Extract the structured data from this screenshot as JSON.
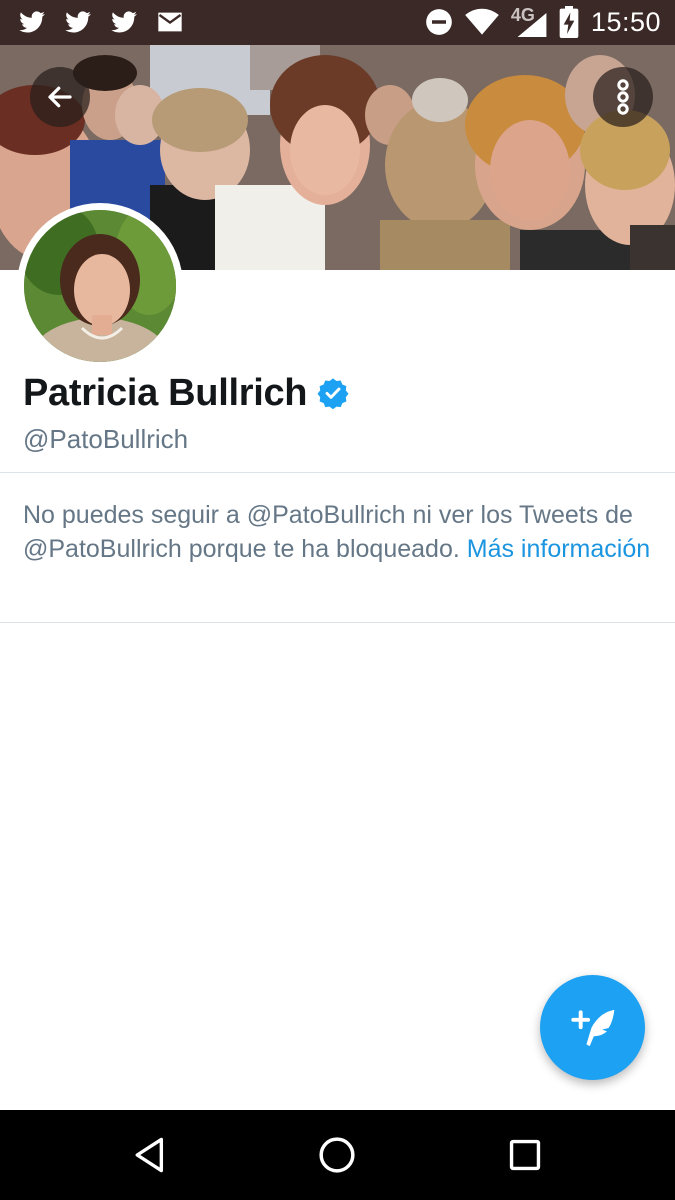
{
  "status_bar": {
    "time": "15:50",
    "network_type": "4G",
    "notification_icons": [
      "twitter-icon",
      "twitter-icon",
      "twitter-icon",
      "mail-icon"
    ],
    "system_icons": [
      "do-not-disturb-icon",
      "wifi-icon",
      "cell-signal-icon",
      "battery-charging-icon"
    ]
  },
  "profile": {
    "display_name": "Patricia Bullrich",
    "verified": true,
    "handle": "@PatoBullrich"
  },
  "blocked_notice": {
    "message": "No puedes seguir a @PatoBullrich ni ver los Tweets de @PatoBullrich porque te ha bloqueado.",
    "link_text": "Más información"
  },
  "colors": {
    "accent": "#1da1f2",
    "link": "#1b95e0",
    "status_bar": "#3a2926",
    "secondary_text": "#657786",
    "primary_text": "#14171a"
  },
  "icons": {
    "back": "arrow-left-icon",
    "more": "more-vertical-icon",
    "verified": "verified-badge-icon",
    "compose": "compose-tweet-icon",
    "nav": [
      "nav-back-icon",
      "nav-home-icon",
      "nav-recents-icon"
    ]
  }
}
